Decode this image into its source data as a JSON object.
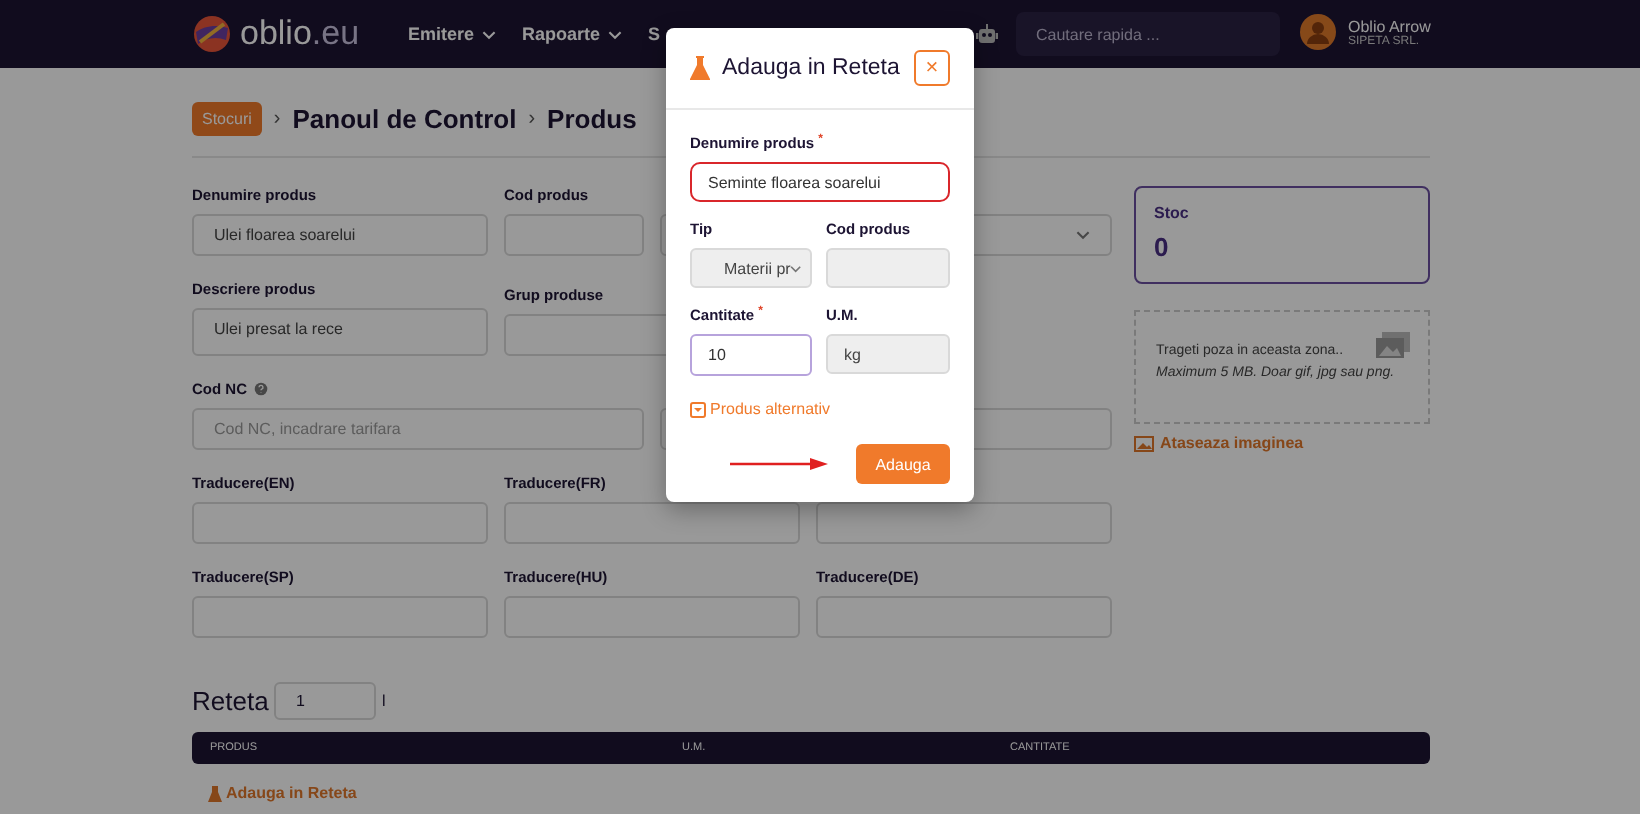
{
  "header": {
    "logo": {
      "name": "oblio",
      "suffix": ".eu"
    },
    "nav": [
      {
        "label": "Emitere",
        "dropdown": true
      },
      {
        "label": "Rapoarte",
        "dropdown": true
      },
      {
        "label": "S",
        "dropdown": false
      }
    ],
    "search": {
      "placeholder": "Cautare rapida ..."
    },
    "user": {
      "name": "Oblio Arrow",
      "company": "SIPETA SRL."
    }
  },
  "breadcrumb": {
    "badge": "Stocuri",
    "separator": "›",
    "items": [
      "Panoul de Control",
      "Produs"
    ]
  },
  "form": {
    "fields": [
      {
        "label": "Denumire produs",
        "kind": "input",
        "value": "Ulei floarea soarelui"
      },
      {
        "label": "Cod produs",
        "kind": "input"
      },
      {
        "kind": "select"
      },
      {
        "label": "Descriere produs",
        "kind": "textarea",
        "value": "Ulei presat la rece"
      },
      {
        "label": "Grup produse",
        "kind": "input"
      },
      {
        "label": "Cod NC",
        "kind": "input",
        "help": true,
        "placeholder": "Cod NC, incadrare tarifara"
      },
      {
        "kind": "input"
      },
      {
        "label": "Traducere(EN)",
        "kind": "input"
      },
      {
        "label": "Traducere(FR)",
        "kind": "input"
      },
      {
        "kind": "input"
      },
      {
        "label": "Traducere(SP)",
        "kind": "input"
      },
      {
        "label": "Traducere(HU)",
        "kind": "input"
      },
      {
        "label": "Traducere(DE)",
        "kind": "input"
      }
    ]
  },
  "stock": {
    "label": "Stoc",
    "value": "0"
  },
  "upload": {
    "hint": "Trageti poza in aceasta zona..",
    "note": "Maximum 5 MB. Doar gif, jpg sau png.",
    "link": "Ataseaza imaginea"
  },
  "recipe": {
    "title": "Reteta",
    "quantity": "1",
    "unit": "l",
    "columns": [
      "PRODUS",
      "U.M.",
      "CANTITATE"
    ],
    "add_link": "Adauga in Reteta"
  },
  "modal": {
    "title": "Adauga in Reteta",
    "close": "×",
    "required_mark": "*",
    "fields": [
      {
        "label": "Denumire produs",
        "kind": "input",
        "required": true,
        "invalid": true,
        "focused": false,
        "disabled": false,
        "value": "Seminte floarea soarelui"
      },
      {
        "label": "Tip",
        "kind": "select",
        "required": false,
        "invalid": false,
        "focused": false,
        "disabled": true,
        "value": "Materii pr"
      },
      {
        "label": "Cod produs",
        "kind": "input",
        "required": false,
        "invalid": false,
        "focused": false,
        "disabled": true
      },
      {
        "label": "Cantitate",
        "kind": "input",
        "required": true,
        "invalid": false,
        "focused": true,
        "disabled": false,
        "value": "10"
      },
      {
        "label": "U.M.",
        "kind": "input",
        "required": false,
        "invalid": false,
        "focused": false,
        "disabled": true,
        "value": "kg"
      }
    ],
    "toggle": "Produs alternativ",
    "button": "Adauga"
  }
}
